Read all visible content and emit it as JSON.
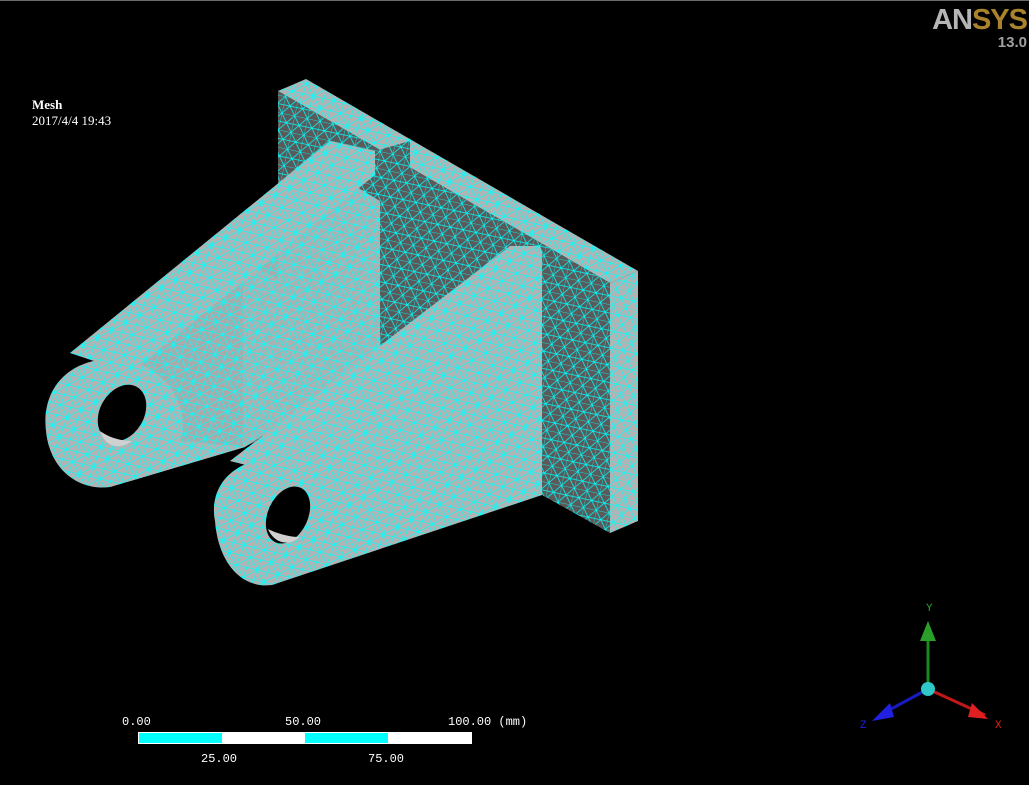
{
  "logo": {
    "brand_left": "AN",
    "brand_right": "SYS",
    "version": "13.0"
  },
  "header": {
    "view_name": "Mesh",
    "timestamp": "2017/4/4 19:43"
  },
  "scale": {
    "top_labels": [
      "0.00",
      "50.00",
      "100.00 (mm)"
    ],
    "bottom_labels": [
      "25.00",
      "75.00"
    ],
    "colors": {
      "fill": "#00ffff",
      "empty": "#ffffff"
    }
  },
  "triad": {
    "x_label": "X",
    "y_label": "Y",
    "z_label": "Z"
  },
  "colors": {
    "mesh_lines": "#00ffff",
    "face_light": "#b3b3b3",
    "face_dark": "#5a5a5a",
    "background": "#000000"
  }
}
